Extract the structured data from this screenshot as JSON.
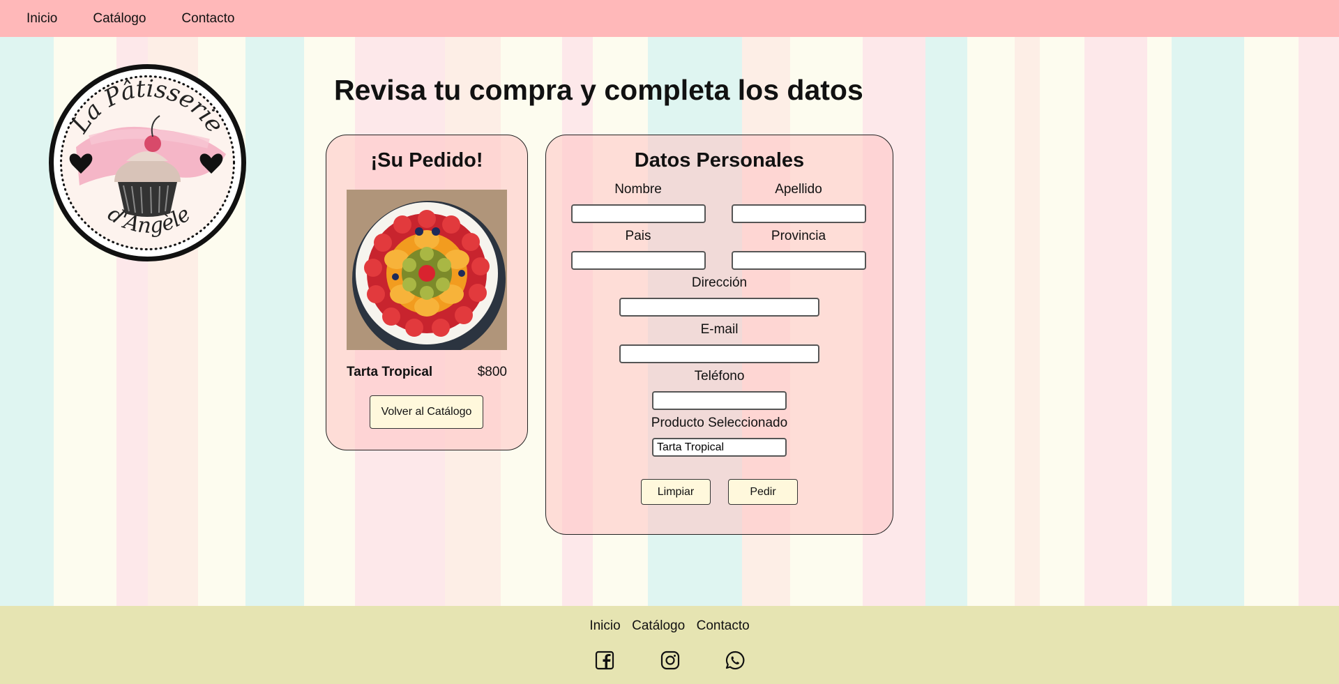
{
  "nav": {
    "items": [
      "Inicio",
      "Catálogo",
      "Contacto"
    ]
  },
  "logo": {
    "line1": "La Pâtisserie",
    "line2": "d'Angèle"
  },
  "page_title": "Revisa tu compra y completa los datos",
  "order": {
    "title": "¡Su Pedido!",
    "product_name": "Tarta Tropical",
    "product_price": "$800",
    "back_button": "Volver al Catálogo"
  },
  "form": {
    "title": "Datos Personales",
    "nombre": {
      "label": "Nombre",
      "value": ""
    },
    "apellido": {
      "label": "Apellido",
      "value": ""
    },
    "pais": {
      "label": "Pais",
      "value": ""
    },
    "provincia": {
      "label": "Provincia",
      "value": ""
    },
    "direccion": {
      "label": "Dirección",
      "value": ""
    },
    "email": {
      "label": "E-mail",
      "value": ""
    },
    "telefono": {
      "label": "Teléfono",
      "value": ""
    },
    "producto": {
      "label": "Producto Seleccionado",
      "value": "Tarta Tropical"
    },
    "clear_button": "Limpiar",
    "submit_button": "Pedir"
  },
  "footer": {
    "nav": [
      "Inicio",
      "Catálogo",
      "Contacto"
    ],
    "social_icons": [
      "facebook-icon",
      "instagram-icon",
      "whatsapp-icon"
    ]
  },
  "colors": {
    "header_bg": "#ffb8b9",
    "footer_bg": "#e6e4b2",
    "button_bg": "#fff8dc"
  }
}
